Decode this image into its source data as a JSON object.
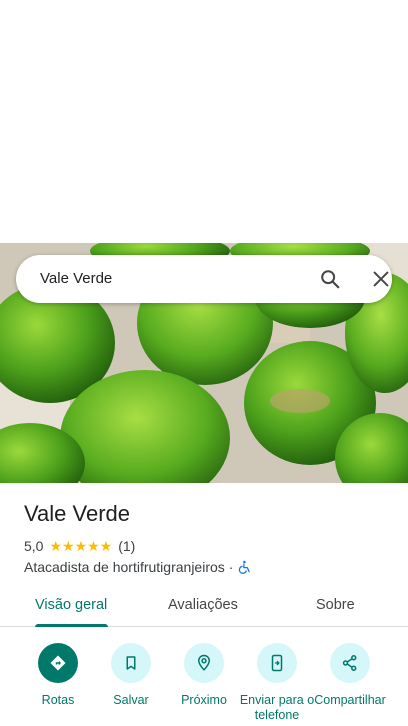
{
  "search": {
    "query": "Vale Verde"
  },
  "place": {
    "name": "Vale Verde",
    "rating": "5,0",
    "stars": "★★★★★",
    "review_count": "(1)",
    "category": "Atacadista de hortifrutigranjeiros",
    "separator": "·"
  },
  "tabs": [
    {
      "label": "Visão geral",
      "active": true
    },
    {
      "label": "Avaliações",
      "active": false
    },
    {
      "label": "Sobre",
      "active": false
    }
  ],
  "actions": [
    {
      "label": "Rotas",
      "icon": "directions-icon"
    },
    {
      "label": "Salvar",
      "icon": "bookmark-icon"
    },
    {
      "label": "Próximo",
      "icon": "nearby-icon"
    },
    {
      "label": "Enviar para o telefone",
      "icon": "send-to-phone-icon"
    },
    {
      "label": "Compartilhar",
      "icon": "share-icon"
    }
  ],
  "colors": {
    "accent": "#00796b",
    "action_bg": "#d6f7f9",
    "star": "#fbbc04"
  }
}
